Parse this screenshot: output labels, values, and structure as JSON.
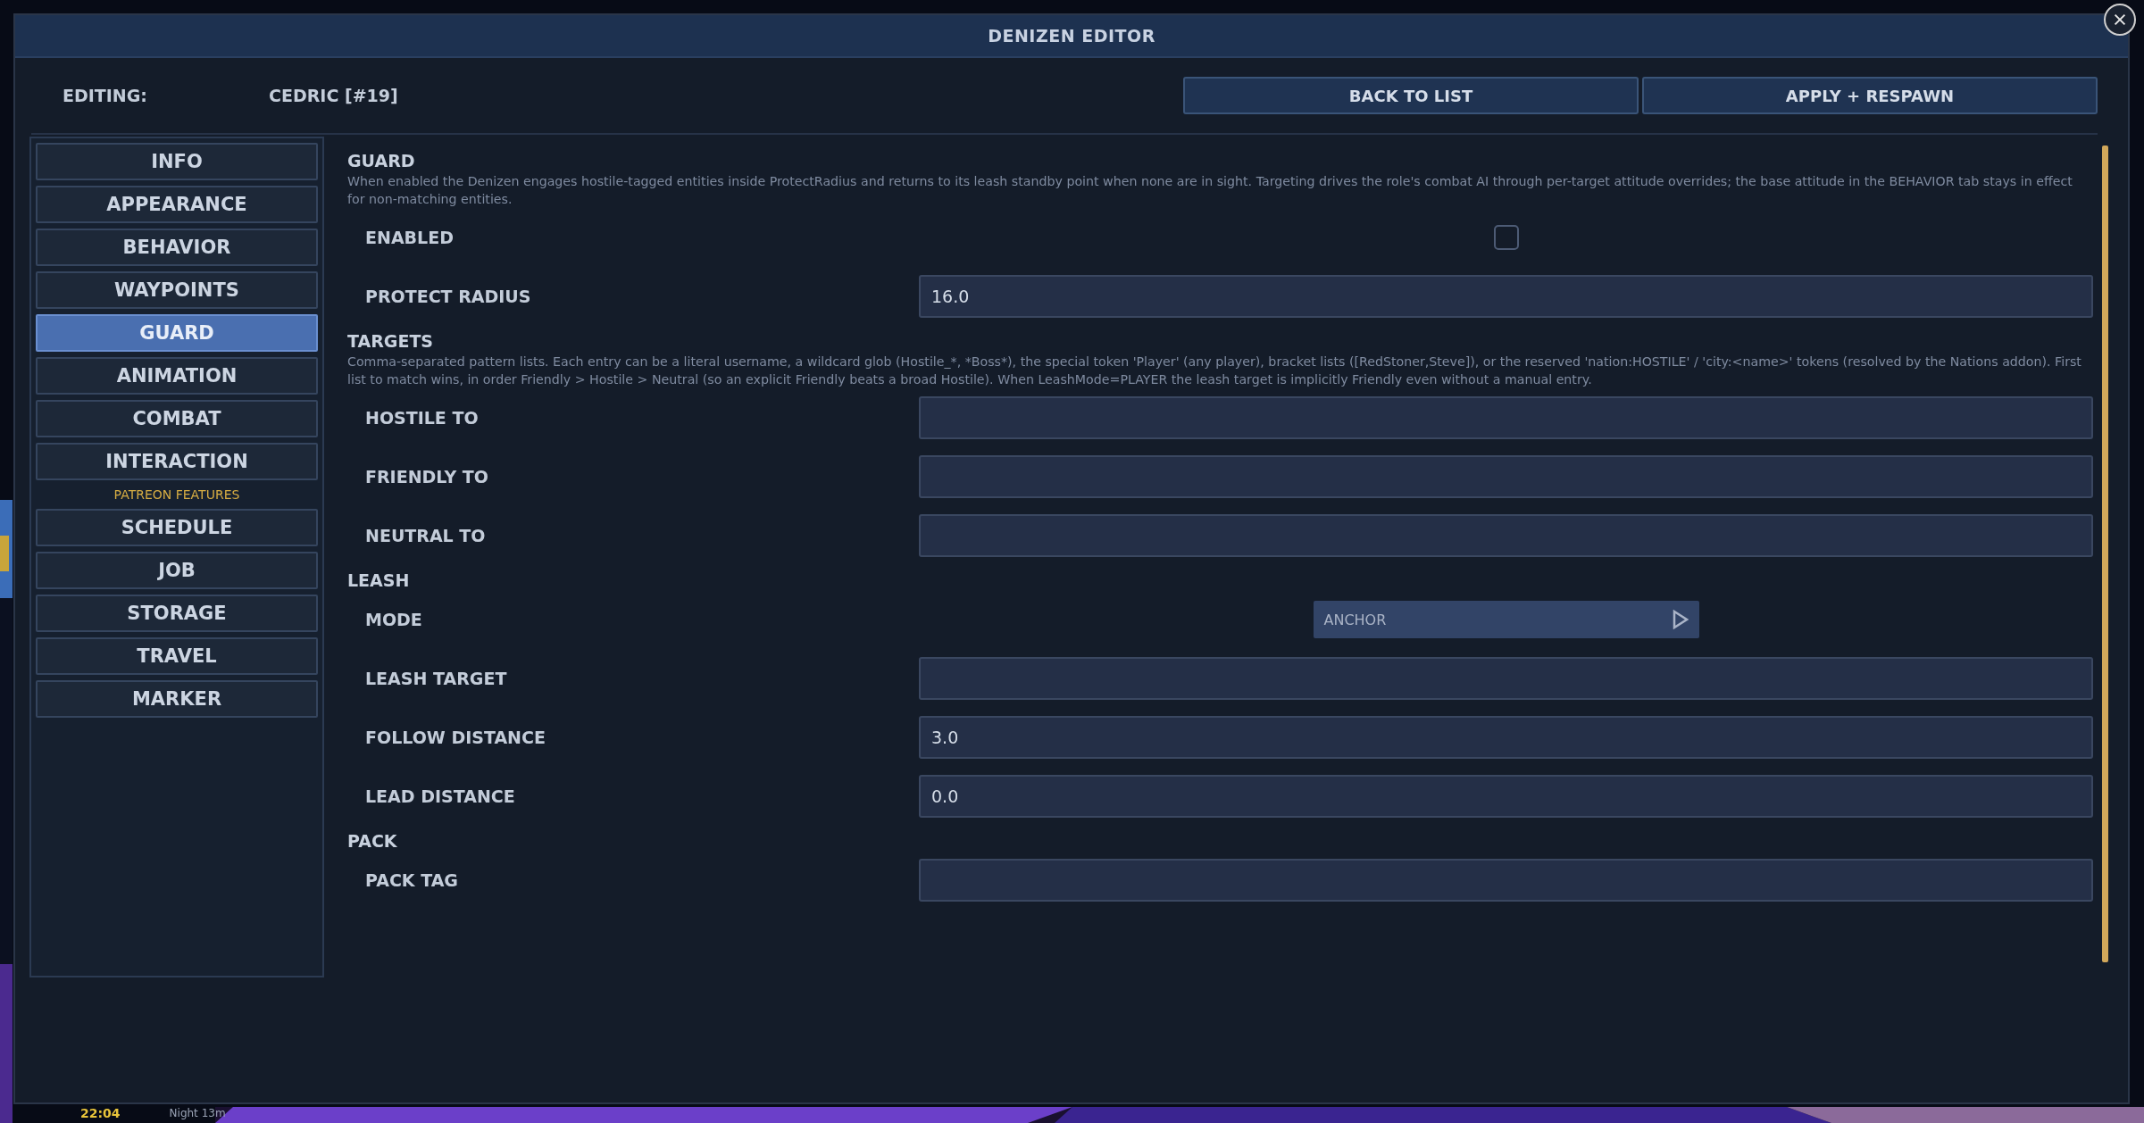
{
  "window": {
    "title": "DENIZEN EDITOR"
  },
  "header": {
    "label": "EDITING:",
    "name": "CEDRIC  [#19]",
    "buttons": [
      "BACK TO LIST",
      "APPLY + RESPAWN"
    ]
  },
  "sidebar": {
    "items": [
      {
        "kind": "tab",
        "label": "INFO",
        "selected": false
      },
      {
        "kind": "tab",
        "label": "APPEARANCE",
        "selected": false
      },
      {
        "kind": "tab",
        "label": "BEHAVIOR",
        "selected": false
      },
      {
        "kind": "tab",
        "label": "WAYPOINTS",
        "selected": false
      },
      {
        "kind": "tab",
        "label": "GUARD",
        "selected": true
      },
      {
        "kind": "tab",
        "label": "ANIMATION",
        "selected": false
      },
      {
        "kind": "tab",
        "label": "COMBAT",
        "selected": false
      },
      {
        "kind": "tab",
        "label": "INTERACTION",
        "selected": false
      },
      {
        "kind": "heading",
        "label": "PATREON FEATURES"
      },
      {
        "kind": "tab",
        "label": "SCHEDULE",
        "selected": false
      },
      {
        "kind": "tab",
        "label": "JOB",
        "selected": false
      },
      {
        "kind": "tab",
        "label": "STORAGE",
        "selected": false
      },
      {
        "kind": "tab",
        "label": "TRAVEL",
        "selected": false
      },
      {
        "kind": "tab",
        "label": "MARKER",
        "selected": false
      }
    ]
  },
  "sections": [
    {
      "title": "GUARD",
      "description": "When enabled the Denizen engages hostile-tagged entities inside ProtectRadius and returns to its leash standby point when none are in sight. Targeting drives the role's combat AI through per-target attitude overrides; the base attitude in the BEHAVIOR tab stays in effect for non-matching entities.",
      "fields": [
        {
          "kind": "checkbox",
          "label": "ENABLED",
          "checked": false
        },
        {
          "kind": "text",
          "label": "PROTECT RADIUS",
          "value": "16.0"
        }
      ]
    },
    {
      "title": "TARGETS",
      "description": "Comma-separated pattern lists. Each entry can be a literal username, a wildcard glob (Hostile_*, *Boss*), the special token 'Player' (any player), bracket lists ([RedStoner,Steve]), or the reserved 'nation:HOSTILE' / 'city:<name>' tokens (resolved by the Nations addon). First list to match wins, in order Friendly > Hostile > Neutral (so an explicit Friendly beats a broad Hostile). When LeashMode=PLAYER the leash target is implicitly Friendly even without a manual entry.",
      "fields": [
        {
          "kind": "text",
          "label": "HOSTILE TO"
        },
        {
          "kind": "text",
          "label": "FRIENDLY TO"
        },
        {
          "kind": "text",
          "label": "NEUTRAL TO"
        }
      ]
    },
    {
      "title": "LEASH",
      "fields": [
        {
          "kind": "select",
          "label": "MODE",
          "value": "ANCHOR"
        },
        {
          "kind": "text",
          "label": "LEASH TARGET"
        },
        {
          "kind": "text",
          "label": "FOLLOW DISTANCE",
          "value": "3.0"
        },
        {
          "kind": "text",
          "label": "LEAD DISTANCE",
          "value": "0.0"
        }
      ]
    },
    {
      "title": "PACK",
      "fields": [
        {
          "kind": "text",
          "label": "PACK TAG"
        }
      ]
    }
  ],
  "hud": {
    "time": "22:04",
    "phase": "Night 13m"
  }
}
